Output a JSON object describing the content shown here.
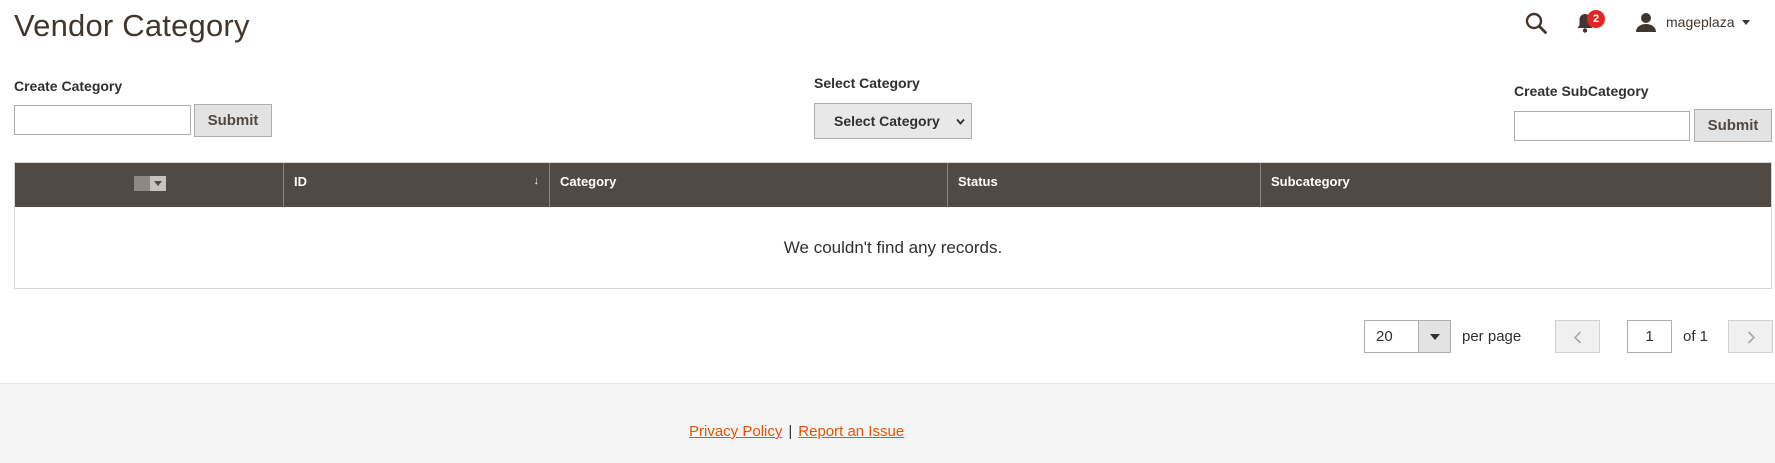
{
  "page": {
    "title": "Vendor Category"
  },
  "header": {
    "notification_count": "2",
    "user_name": "mageplaza"
  },
  "forms": {
    "create_category": {
      "label": "Create Category",
      "value": "",
      "submit_label": "Submit"
    },
    "select_category": {
      "label": "Select Category",
      "selected": "Select Category"
    },
    "create_subcategory": {
      "label": "Create SubCategory",
      "value": "",
      "submit_label": "Submit"
    }
  },
  "grid": {
    "columns": [
      {
        "label": "",
        "key": "mass_select"
      },
      {
        "label": "ID",
        "key": "id",
        "sort": "↓"
      },
      {
        "label": "Category",
        "key": "category"
      },
      {
        "label": "Status",
        "key": "status"
      },
      {
        "label": "Subcategory",
        "key": "subcategory"
      }
    ],
    "rows": [],
    "empty_message": "We couldn't find any records."
  },
  "pagination": {
    "per_page": "20",
    "per_page_label": "per page",
    "current_page": "1",
    "total_label": "of 1"
  },
  "footer": {
    "privacy_label": "Privacy Policy",
    "separator": "|",
    "report_label": "Report an Issue"
  },
  "colors": {
    "grid_header": "#514943",
    "link": "#eb5202",
    "badge": "#e22626",
    "footer_bg": "#f5f5f5"
  },
  "icons": [
    "search-icon",
    "bell-icon",
    "user-icon",
    "chevron-down-icon",
    "chevron-left-icon",
    "chevron-right-icon"
  ]
}
